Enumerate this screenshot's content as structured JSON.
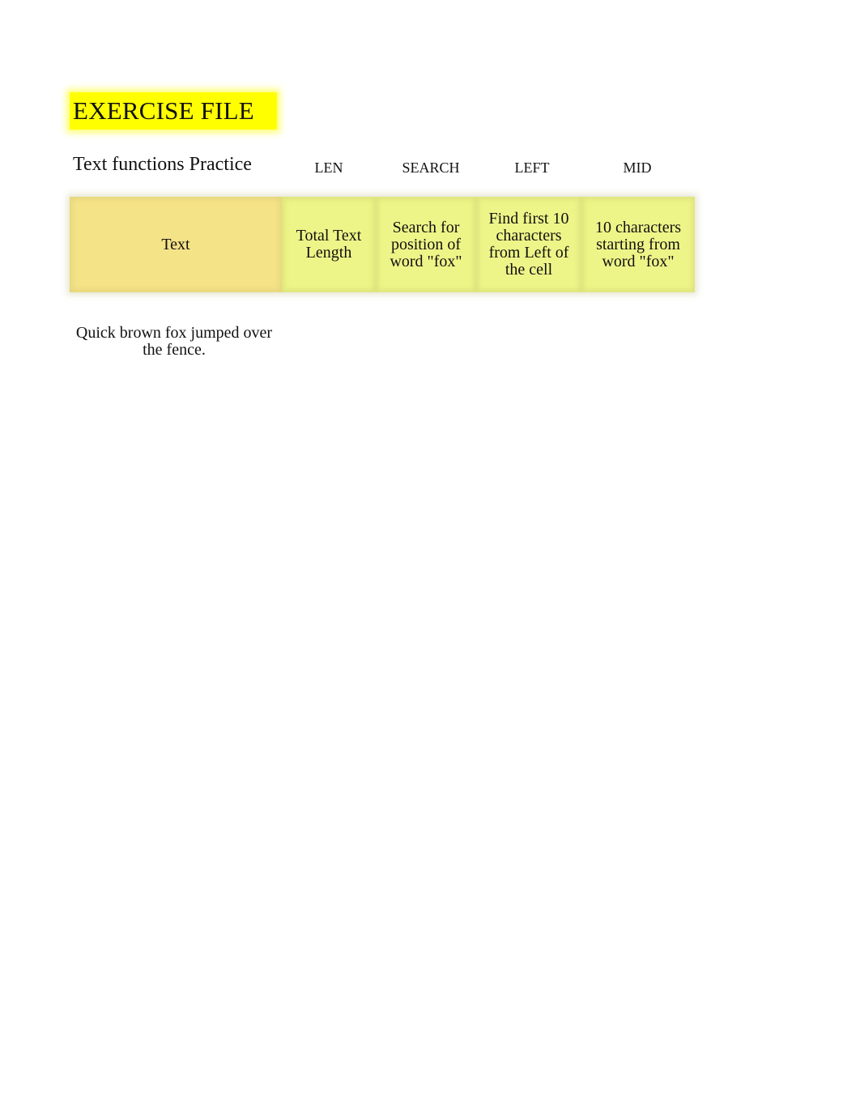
{
  "title": "EXERCISE FILE",
  "subtitle": "Text functions Practice",
  "functions": [
    "LEN",
    "SEARCH",
    "LEFT",
    "MID"
  ],
  "header": {
    "text": "Text",
    "len": "Total Text Length",
    "search": "Search for position of word \"fox\"",
    "left": "Find first 10 characters from Left of the cell",
    "mid": "10 characters starting from word \"fox\""
  },
  "rows": [
    {
      "text": "Quick brown fox jumped over the fence.",
      "len": "",
      "search": "",
      "left": "",
      "mid": ""
    }
  ],
  "colors": {
    "title_highlight": "#ffff00",
    "text_header_fill": "#f5e388",
    "function_header_fill": "#eef588"
  }
}
